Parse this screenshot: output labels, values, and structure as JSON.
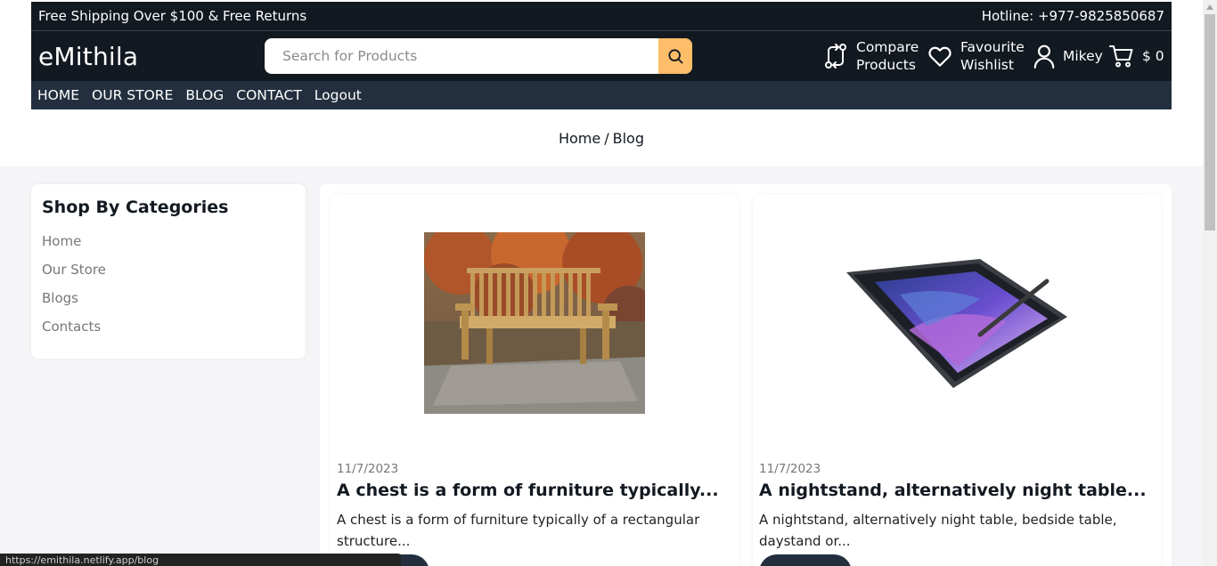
{
  "topbar": {
    "left_text": "Free Shipping Over $100 & Free Returns",
    "right_text": "Hotline: +977-9825850687"
  },
  "header": {
    "brand": "eMithila",
    "search": {
      "placeholder": "Search for Products",
      "value": "",
      "icon": "search-icon"
    },
    "compare": {
      "line1": "Compare",
      "line2": "Products",
      "icon": "compare-icon"
    },
    "wishlist": {
      "line1": "Favourite",
      "line2": "Wishlist",
      "icon": "heart-icon"
    },
    "account": {
      "label": "Mikey",
      "icon": "user-icon"
    },
    "cart": {
      "total": "$ 0",
      "icon": "cart-icon"
    },
    "accent_color": "#febd69",
    "bg_color": "#131921",
    "nav_bg_color": "#232f3e"
  },
  "nav": {
    "items": [
      "HOME",
      "OUR STORE",
      "BLOG",
      "CONTACT",
      "Logout"
    ]
  },
  "breadcrumb": {
    "home": "Home",
    "separator": "/",
    "current": "Blog"
  },
  "sidebar": {
    "title": "Shop By Categories",
    "items": [
      "Home",
      "Our Store",
      "Blogs",
      "Contacts"
    ]
  },
  "blogs": [
    {
      "date": "11/7/2023",
      "title": "A chest is a form of furniture typically...",
      "desc": "A chest is a form of furniture typically of a rectangular structure...",
      "image": "wooden-bench-photo"
    },
    {
      "date": "11/7/2023",
      "title": "A nightstand, alternatively night table...",
      "desc": "A nightstand, alternatively night table, bedside table, daystand or...",
      "image": "tablet-with-stylus-photo"
    }
  ],
  "status_bar": {
    "url": "https://emithila.netlify.app/blog"
  }
}
